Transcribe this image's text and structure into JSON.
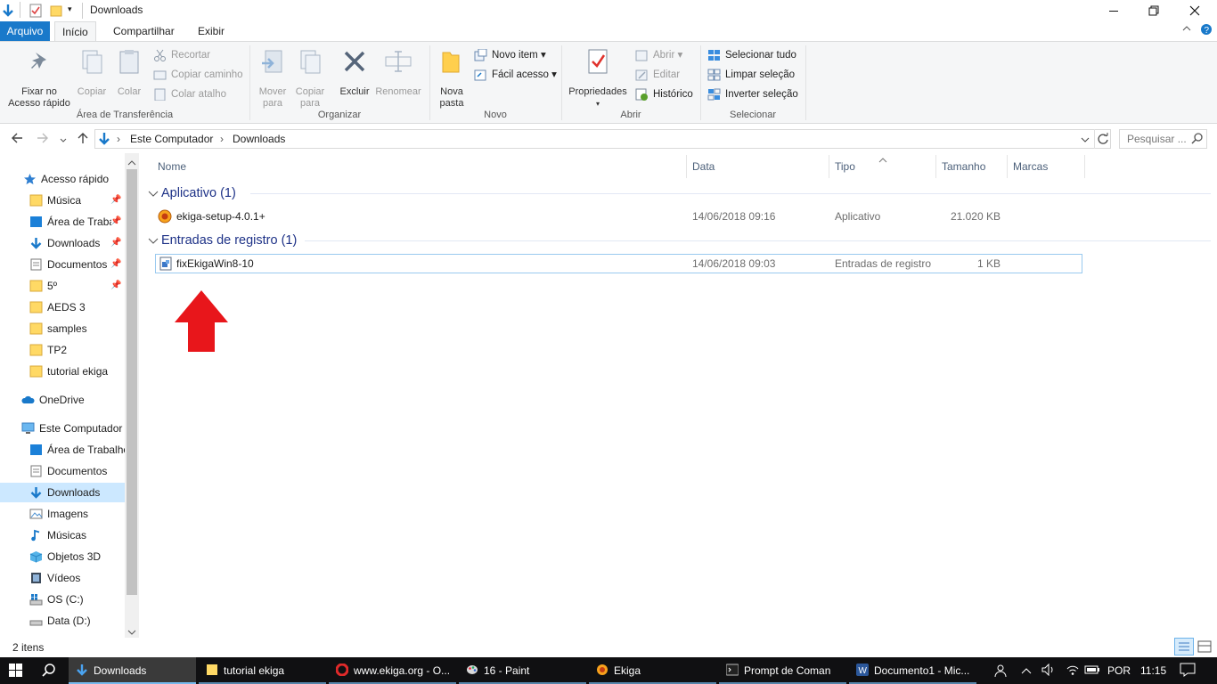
{
  "window": {
    "title": "Downloads",
    "minimize": "🗕",
    "maximize": "🗗",
    "close": "✕"
  },
  "tabs": [
    "Arquivo",
    "Início",
    "Compartilhar",
    "Exibir"
  ],
  "ribbon": {
    "clipboard": {
      "pin_label": "Fixar no Acesso rápido",
      "copy_label": "Copiar",
      "paste_label": "Colar",
      "cut_label": "Recortar",
      "copy_path_label": "Copiar caminho",
      "paste_shortcut_label": "Colar atalho",
      "group_label": "Área de Transferência"
    },
    "organize": {
      "move_label": "Mover para",
      "copy_to_label": "Copiar para",
      "delete_label": "Excluir",
      "rename_label": "Renomear",
      "group_label": "Organizar"
    },
    "new": {
      "new_folder_label": "Nova pasta",
      "new_item_label": "Novo item",
      "easy_access_label": "Fácil acesso",
      "group_label": "Novo"
    },
    "open": {
      "properties_label": "Propriedades",
      "open_label": "Abrir",
      "edit_label": "Editar",
      "history_label": "Histórico",
      "group_label": "Abrir"
    },
    "select": {
      "select_all_label": "Selecionar tudo",
      "select_none_label": "Limpar seleção",
      "invert_label": "Inverter seleção",
      "group_label": "Selecionar"
    }
  },
  "address": {
    "crumbs": [
      "Este Computador",
      "Downloads"
    ],
    "search_placeholder": "Pesquisar ..."
  },
  "nav": {
    "quick_access": "Acesso rápido",
    "quick_items": [
      "Música",
      "Área de Trabalho",
      "Downloads",
      "Documentos",
      "5º",
      "AEDS 3",
      "samples",
      "TP2",
      "tutorial ekiga"
    ],
    "onedrive": "OneDrive",
    "this_pc": "Este Computador",
    "pc_items": [
      "Área de Trabalho",
      "Documentos",
      "Downloads",
      "Imagens",
      "Músicas",
      "Objetos 3D",
      "Vídeos",
      "OS (C:)",
      "Data (D:)"
    ]
  },
  "columns": [
    "Nome",
    "Data",
    "Tipo",
    "Tamanho",
    "Marcas"
  ],
  "groups": [
    {
      "title": "Aplicativo (1)",
      "files": [
        {
          "name": "ekiga-setup-4.0.1+",
          "date": "14/06/2018 09:16",
          "type": "Aplicativo",
          "size": "21.020 KB"
        }
      ]
    },
    {
      "title": "Entradas de registro (1)",
      "files": [
        {
          "name": "fixEkigaWin8-10",
          "date": "14/06/2018 09:03",
          "type": "Entradas de registro",
          "size": "1 KB"
        }
      ]
    }
  ],
  "status": {
    "item_count": "2 itens"
  },
  "taskbar": {
    "items": [
      "Downloads",
      "tutorial ekiga",
      "www.ekiga.org - O...",
      "16 - Paint",
      "Ekiga",
      "Prompt de Coman",
      "Documento1 - Mic..."
    ],
    "language": "POR",
    "time": "11:15"
  },
  "colors": {
    "accent": "#1979ca",
    "arrow": "#e8161b",
    "selection": "#cce8ff"
  }
}
